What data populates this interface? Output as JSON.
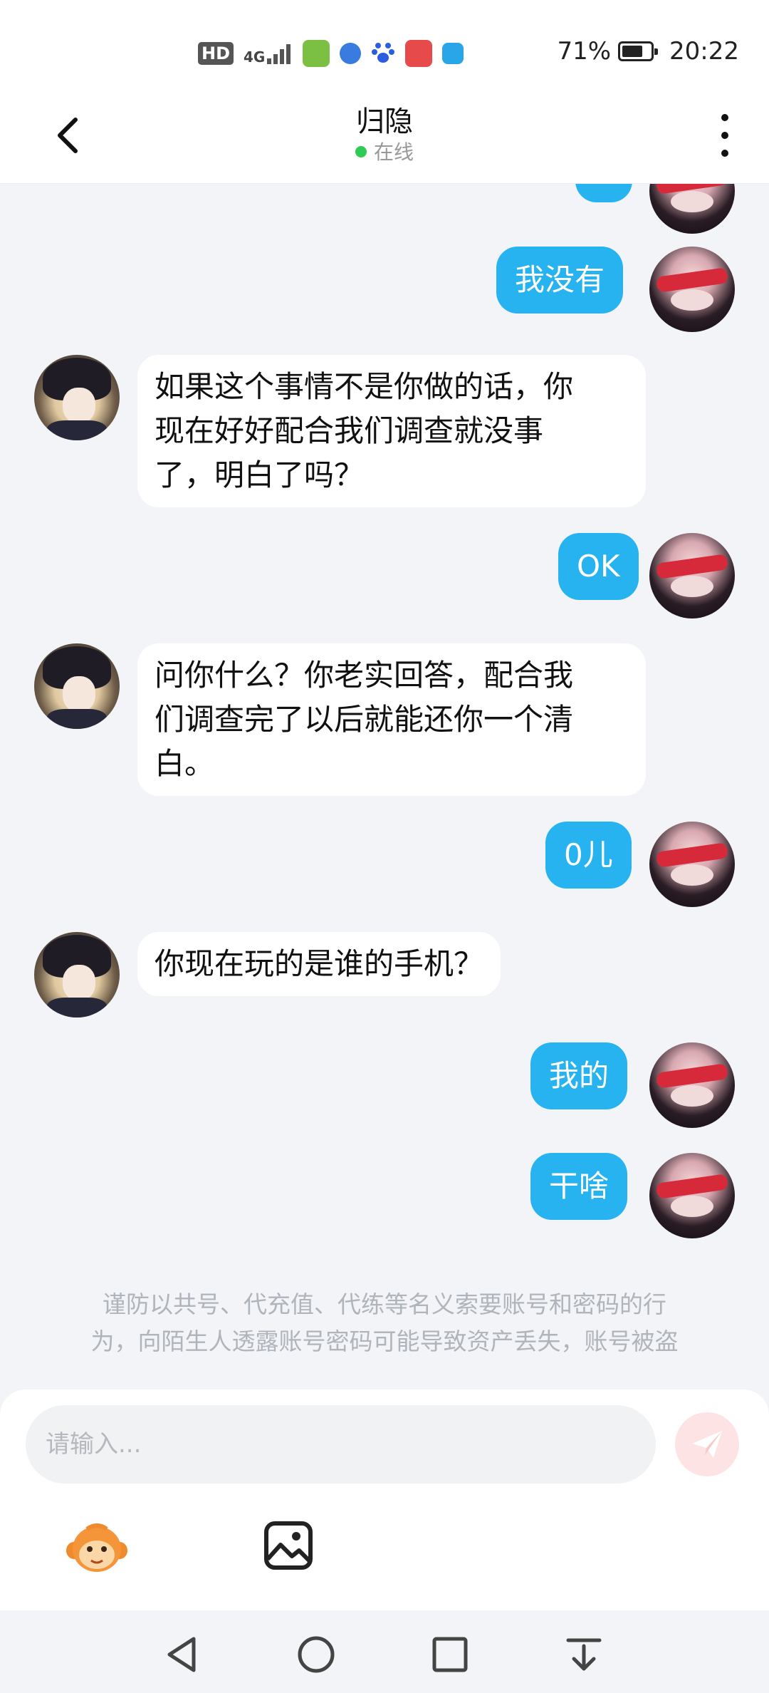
{
  "status_bar": {
    "hd": "HD",
    "network": "4G",
    "battery_percent": "71%",
    "battery_level": 0.71,
    "time": "20:22",
    "app_icons": [
      "wifi-app-icon",
      "blue-orb-app-icon",
      "paw-app-icon",
      "book-app-icon",
      "briefcase-app-icon"
    ]
  },
  "header": {
    "title": "归隐",
    "status": "在线"
  },
  "colors": {
    "my_bubble": "#27b2f0",
    "other_bubble": "#ffffff",
    "background": "#f2f4f8",
    "online_dot": "#2ecc55"
  },
  "messages": [
    {
      "sender": "me",
      "text": "我没有"
    },
    {
      "sender": "other",
      "lines": [
        "如果这个事情不是你做的话，你",
        "现在好好配合我们调查就没事",
        "了，明白了吗？"
      ]
    },
    {
      "sender": "me",
      "text": "OK"
    },
    {
      "sender": "other",
      "lines": [
        "问你什么？你老实回答，配合我",
        "们调查完了以后就能还你一个清",
        "白。"
      ]
    },
    {
      "sender": "me",
      "text": "0儿"
    },
    {
      "sender": "other",
      "lines": [
        "你现在玩的是谁的手机？"
      ]
    },
    {
      "sender": "me",
      "text": "我的"
    },
    {
      "sender": "me",
      "text": "干啥"
    }
  ],
  "warning": {
    "line1": "谨防以共号、代充值、代练等名义索要账号和密码的行",
    "line2": "为，向陌生人透露账号密码可能导致资产丢失，账号被盗"
  },
  "input": {
    "placeholder": "请输入..."
  },
  "nav": [
    "back-icon",
    "home-icon",
    "recents-icon",
    "notification-down-icon"
  ]
}
